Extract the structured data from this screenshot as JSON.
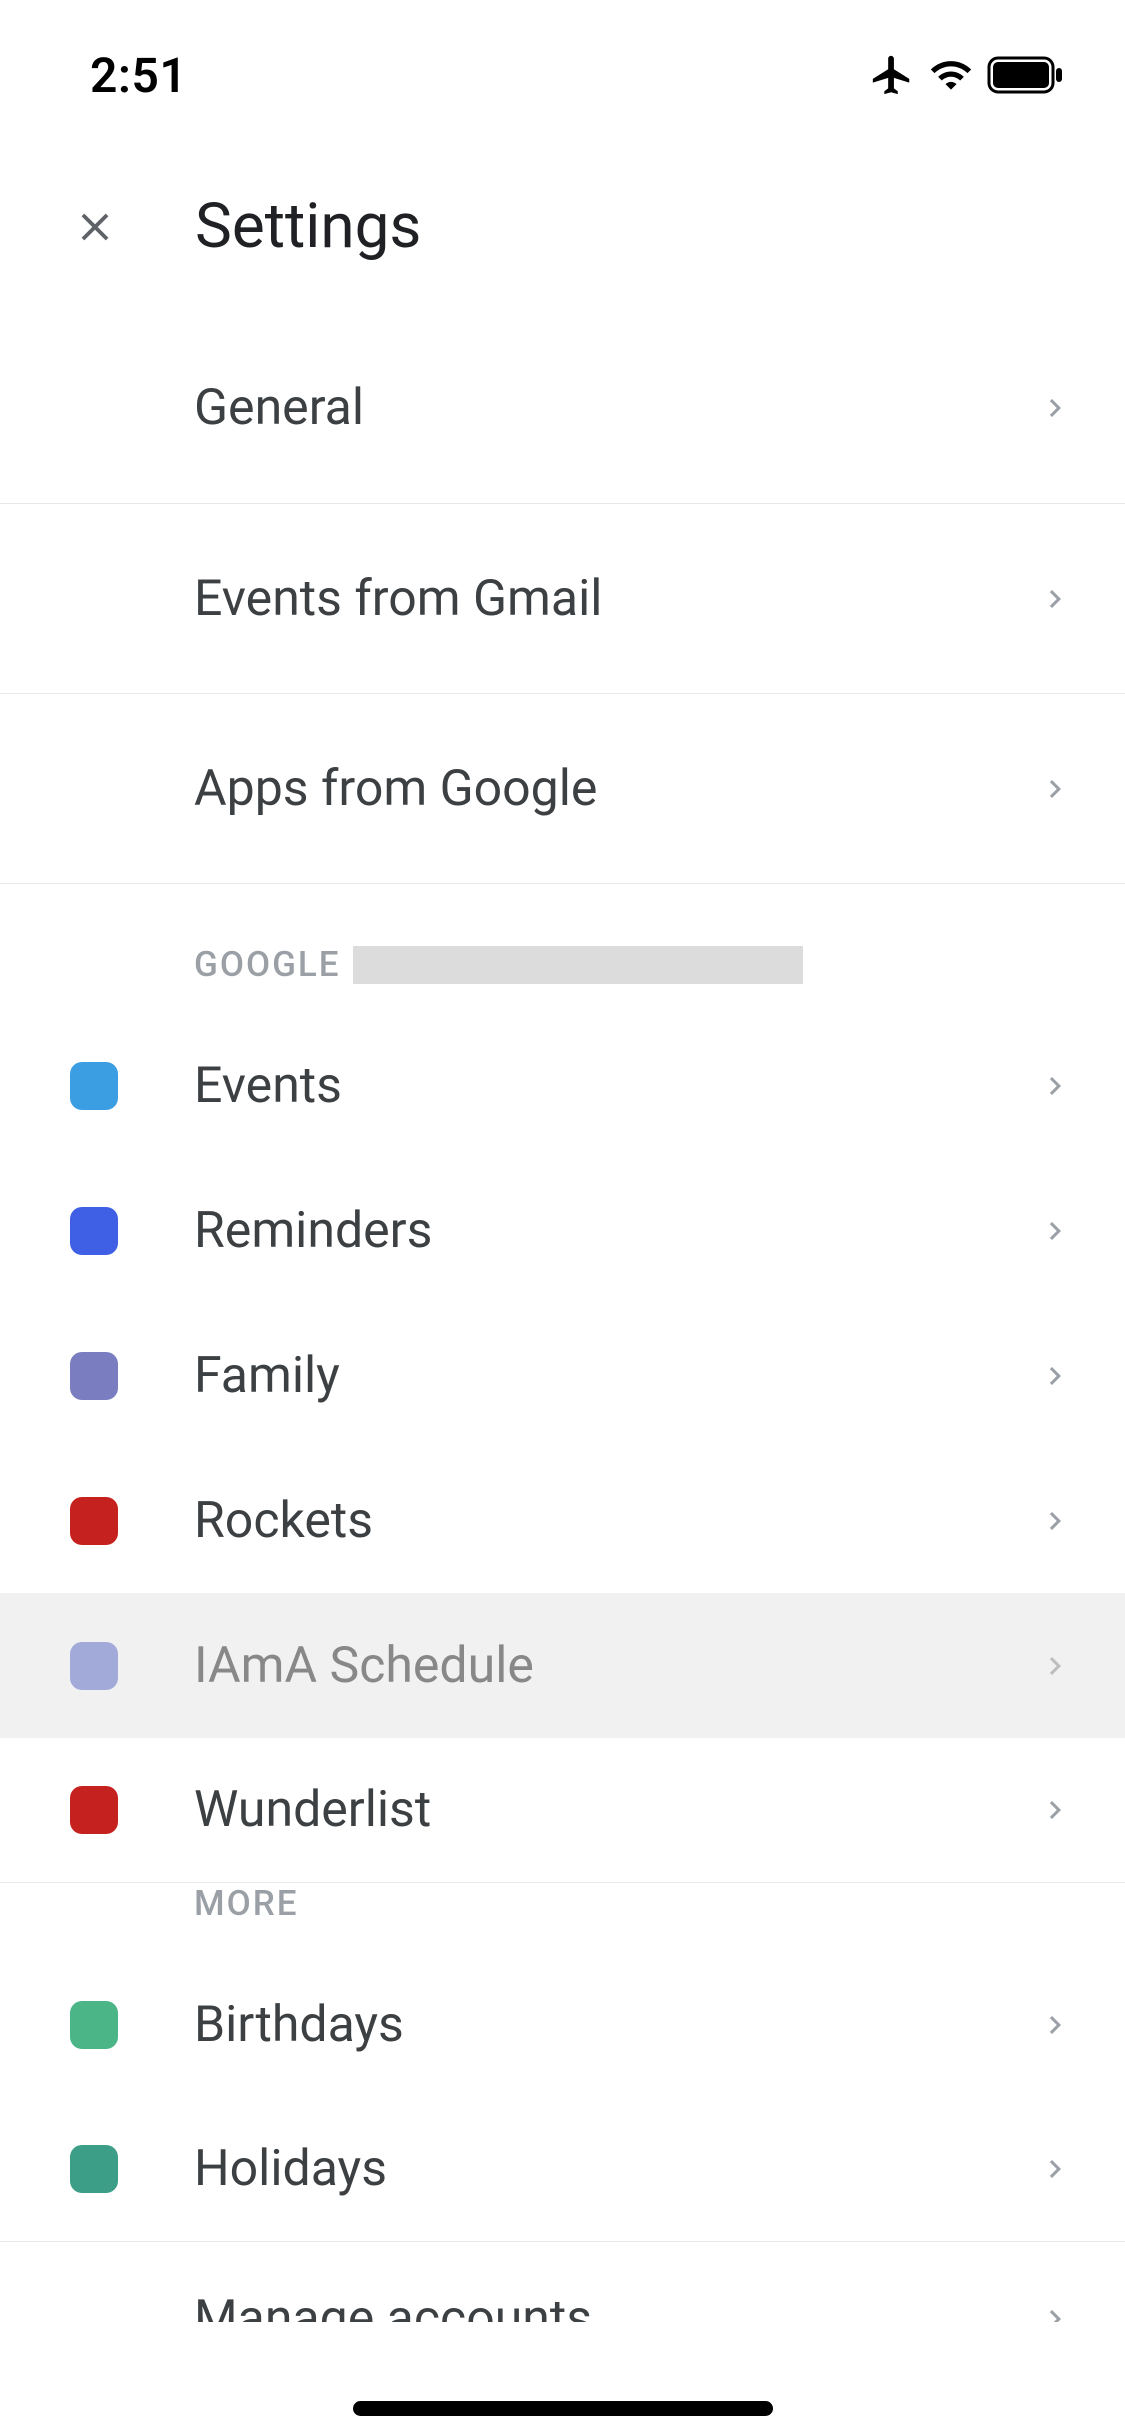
{
  "status_bar": {
    "time": "2:51"
  },
  "header": {
    "title": "Settings"
  },
  "top_items": [
    {
      "label": "General"
    },
    {
      "label": "Events from Gmail"
    },
    {
      "label": "Apps from Google"
    }
  ],
  "account_section": {
    "header": "GOOGLE",
    "calendars": [
      {
        "label": "Events",
        "color": "#3b9ee3"
      },
      {
        "label": "Reminders",
        "color": "#3f5fe5"
      },
      {
        "label": "Family",
        "color": "#7a7dc0"
      },
      {
        "label": "Rockets",
        "color": "#c5221f"
      },
      {
        "label": "IAmA Schedule",
        "color": "#a2aad9",
        "highlighted": true
      },
      {
        "label": "Wunderlist",
        "color": "#c5221f"
      }
    ]
  },
  "more_section": {
    "header": "MORE",
    "calendars": [
      {
        "label": "Birthdays",
        "color": "#4cb587"
      },
      {
        "label": "Holidays",
        "color": "#3d9e87"
      }
    ]
  },
  "bottom": {
    "label": "Manage accounts"
  }
}
